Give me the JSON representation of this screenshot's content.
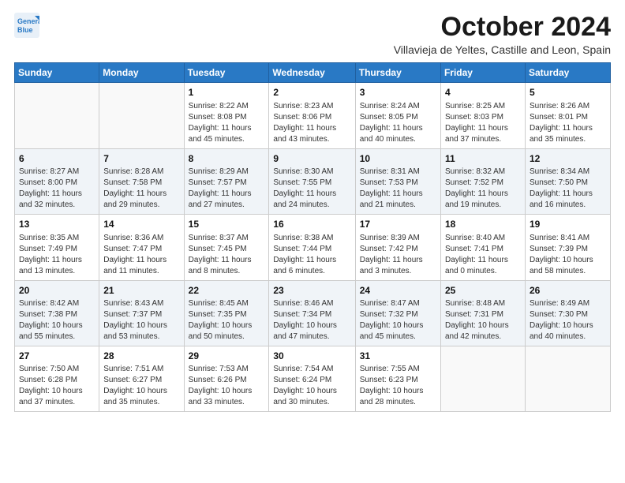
{
  "logo": {
    "line1": "General",
    "line2": "Blue"
  },
  "title": "October 2024",
  "location": "Villavieja de Yeltes, Castille and Leon, Spain",
  "days_of_week": [
    "Sunday",
    "Monday",
    "Tuesday",
    "Wednesday",
    "Thursday",
    "Friday",
    "Saturday"
  ],
  "weeks": [
    [
      {
        "day": "",
        "info": ""
      },
      {
        "day": "",
        "info": ""
      },
      {
        "day": "1",
        "info": "Sunrise: 8:22 AM\nSunset: 8:08 PM\nDaylight: 11 hours and 45 minutes."
      },
      {
        "day": "2",
        "info": "Sunrise: 8:23 AM\nSunset: 8:06 PM\nDaylight: 11 hours and 43 minutes."
      },
      {
        "day": "3",
        "info": "Sunrise: 8:24 AM\nSunset: 8:05 PM\nDaylight: 11 hours and 40 minutes."
      },
      {
        "day": "4",
        "info": "Sunrise: 8:25 AM\nSunset: 8:03 PM\nDaylight: 11 hours and 37 minutes."
      },
      {
        "day": "5",
        "info": "Sunrise: 8:26 AM\nSunset: 8:01 PM\nDaylight: 11 hours and 35 minutes."
      }
    ],
    [
      {
        "day": "6",
        "info": "Sunrise: 8:27 AM\nSunset: 8:00 PM\nDaylight: 11 hours and 32 minutes."
      },
      {
        "day": "7",
        "info": "Sunrise: 8:28 AM\nSunset: 7:58 PM\nDaylight: 11 hours and 29 minutes."
      },
      {
        "day": "8",
        "info": "Sunrise: 8:29 AM\nSunset: 7:57 PM\nDaylight: 11 hours and 27 minutes."
      },
      {
        "day": "9",
        "info": "Sunrise: 8:30 AM\nSunset: 7:55 PM\nDaylight: 11 hours and 24 minutes."
      },
      {
        "day": "10",
        "info": "Sunrise: 8:31 AM\nSunset: 7:53 PM\nDaylight: 11 hours and 21 minutes."
      },
      {
        "day": "11",
        "info": "Sunrise: 8:32 AM\nSunset: 7:52 PM\nDaylight: 11 hours and 19 minutes."
      },
      {
        "day": "12",
        "info": "Sunrise: 8:34 AM\nSunset: 7:50 PM\nDaylight: 11 hours and 16 minutes."
      }
    ],
    [
      {
        "day": "13",
        "info": "Sunrise: 8:35 AM\nSunset: 7:49 PM\nDaylight: 11 hours and 13 minutes."
      },
      {
        "day": "14",
        "info": "Sunrise: 8:36 AM\nSunset: 7:47 PM\nDaylight: 11 hours and 11 minutes."
      },
      {
        "day": "15",
        "info": "Sunrise: 8:37 AM\nSunset: 7:45 PM\nDaylight: 11 hours and 8 minutes."
      },
      {
        "day": "16",
        "info": "Sunrise: 8:38 AM\nSunset: 7:44 PM\nDaylight: 11 hours and 6 minutes."
      },
      {
        "day": "17",
        "info": "Sunrise: 8:39 AM\nSunset: 7:42 PM\nDaylight: 11 hours and 3 minutes."
      },
      {
        "day": "18",
        "info": "Sunrise: 8:40 AM\nSunset: 7:41 PM\nDaylight: 11 hours and 0 minutes."
      },
      {
        "day": "19",
        "info": "Sunrise: 8:41 AM\nSunset: 7:39 PM\nDaylight: 10 hours and 58 minutes."
      }
    ],
    [
      {
        "day": "20",
        "info": "Sunrise: 8:42 AM\nSunset: 7:38 PM\nDaylight: 10 hours and 55 minutes."
      },
      {
        "day": "21",
        "info": "Sunrise: 8:43 AM\nSunset: 7:37 PM\nDaylight: 10 hours and 53 minutes."
      },
      {
        "day": "22",
        "info": "Sunrise: 8:45 AM\nSunset: 7:35 PM\nDaylight: 10 hours and 50 minutes."
      },
      {
        "day": "23",
        "info": "Sunrise: 8:46 AM\nSunset: 7:34 PM\nDaylight: 10 hours and 47 minutes."
      },
      {
        "day": "24",
        "info": "Sunrise: 8:47 AM\nSunset: 7:32 PM\nDaylight: 10 hours and 45 minutes."
      },
      {
        "day": "25",
        "info": "Sunrise: 8:48 AM\nSunset: 7:31 PM\nDaylight: 10 hours and 42 minutes."
      },
      {
        "day": "26",
        "info": "Sunrise: 8:49 AM\nSunset: 7:30 PM\nDaylight: 10 hours and 40 minutes."
      }
    ],
    [
      {
        "day": "27",
        "info": "Sunrise: 7:50 AM\nSunset: 6:28 PM\nDaylight: 10 hours and 37 minutes."
      },
      {
        "day": "28",
        "info": "Sunrise: 7:51 AM\nSunset: 6:27 PM\nDaylight: 10 hours and 35 minutes."
      },
      {
        "day": "29",
        "info": "Sunrise: 7:53 AM\nSunset: 6:26 PM\nDaylight: 10 hours and 33 minutes."
      },
      {
        "day": "30",
        "info": "Sunrise: 7:54 AM\nSunset: 6:24 PM\nDaylight: 10 hours and 30 minutes."
      },
      {
        "day": "31",
        "info": "Sunrise: 7:55 AM\nSunset: 6:23 PM\nDaylight: 10 hours and 28 minutes."
      },
      {
        "day": "",
        "info": ""
      },
      {
        "day": "",
        "info": ""
      }
    ]
  ]
}
